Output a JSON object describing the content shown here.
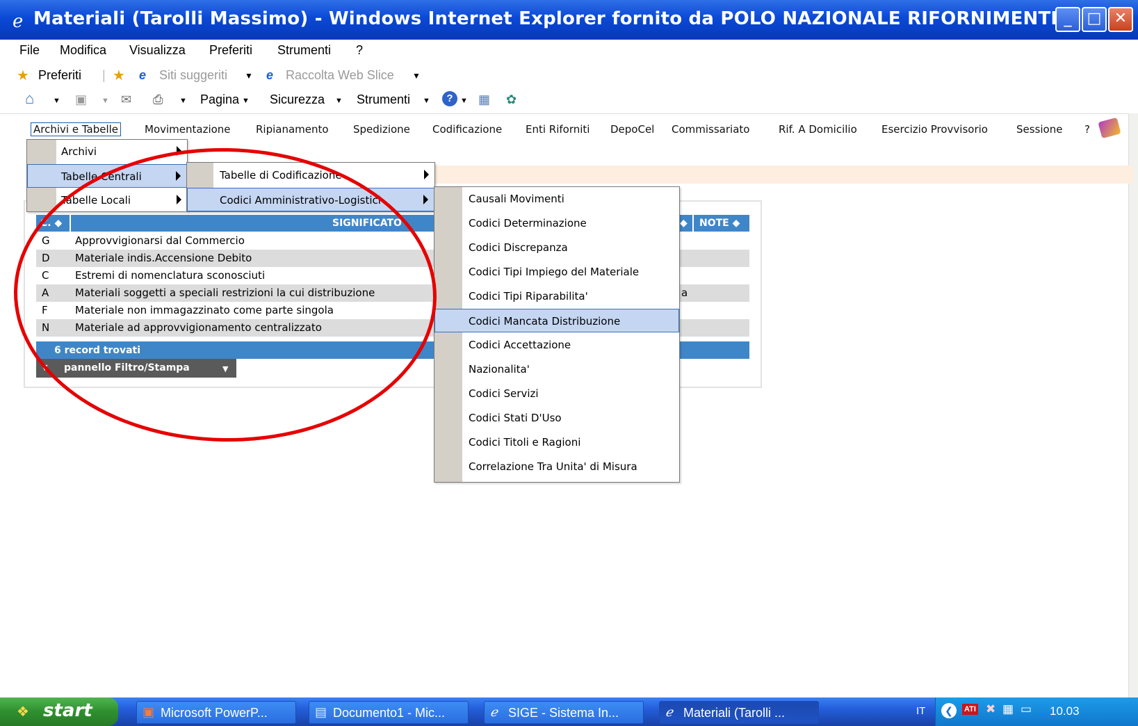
{
  "window": {
    "title": "Materiali (Tarolli Massimo) - Windows Internet Explorer fornito da POLO NAZIONALE RIFORNIMENTI"
  },
  "ie_menubar": [
    "File",
    "Modifica",
    "Visualizza",
    "Preferiti",
    "Strumenti",
    "?"
  ],
  "favbar": {
    "favorites": "Preferiti",
    "suggested": "Siti suggeriti",
    "webslice": "Raccolta Web Slice"
  },
  "cmdbar": {
    "page": "Pagina",
    "security": "Sicurezza",
    "tools": "Strumenti"
  },
  "app_nav": [
    "Archivi e Tabelle",
    "Movimentazione",
    "Ripianamento",
    "Spedizione",
    "Codificazione",
    "Enti Riforniti",
    "DepoCel",
    "Commissariato",
    "Rif. A Domicilio",
    "Esercizio Provvisorio",
    "Sessione",
    "?"
  ],
  "menu1": [
    "Archivi",
    "Tabelle Centrali",
    "Tabelle Locali"
  ],
  "menu2": [
    "Tabelle di Codificazione",
    "Codici Amministrativo-Logistici"
  ],
  "menu3": [
    "Causali Movimenti",
    "Codici Determinazione",
    "Codici Discrepanza",
    "Codici Tipi Impiego del Materiale",
    "Codici Tipi Riparabilita'",
    "Codici Mancata Distribuzione",
    "Codici Accettazione",
    "Nazionalita'",
    "Codici Servizi",
    "Codici Stati D'Uso",
    "Codici Titoli e Ragioni",
    "Correlazione Tra Unita' di Misura"
  ],
  "table": {
    "col_code": "C. ◆",
    "col_meaning": "SIGNIFICATO",
    "col_notes": "NOTE ◆",
    "rows": [
      {
        "code": "G",
        "meaning": "Approvvigionarsi dal Commercio"
      },
      {
        "code": "D",
        "meaning": "Materiale indis.Accensione Debito"
      },
      {
        "code": "C",
        "meaning": "Estremi di nomenclatura sconosciuti"
      },
      {
        "code": "A",
        "meaning": "Materiali soggetti a speciali restrizioni la cui distribuzione"
      },
      {
        "code": "F",
        "meaning": "Materiale non immagazzinato come parte singola"
      },
      {
        "code": "N",
        "meaning": "Materiale ad approvvigionamento centralizzato"
      }
    ],
    "row3_overflow": "a",
    "footer": "6 record trovati",
    "filter": "pannello Filtro/Stampa"
  },
  "taskbar": {
    "start": "start",
    "tasks": [
      "Microsoft PowerP...",
      "Documento1 - Mic...",
      "SIGE - Sistema In...",
      "Materiali (Tarolli ..."
    ],
    "lang": "IT",
    "clock": "10.03"
  },
  "colors": {
    "title_bar": "#0a49d6",
    "table_header": "#3f86c8",
    "highlight": "#c5d6f2",
    "annotation": "#e60000"
  }
}
